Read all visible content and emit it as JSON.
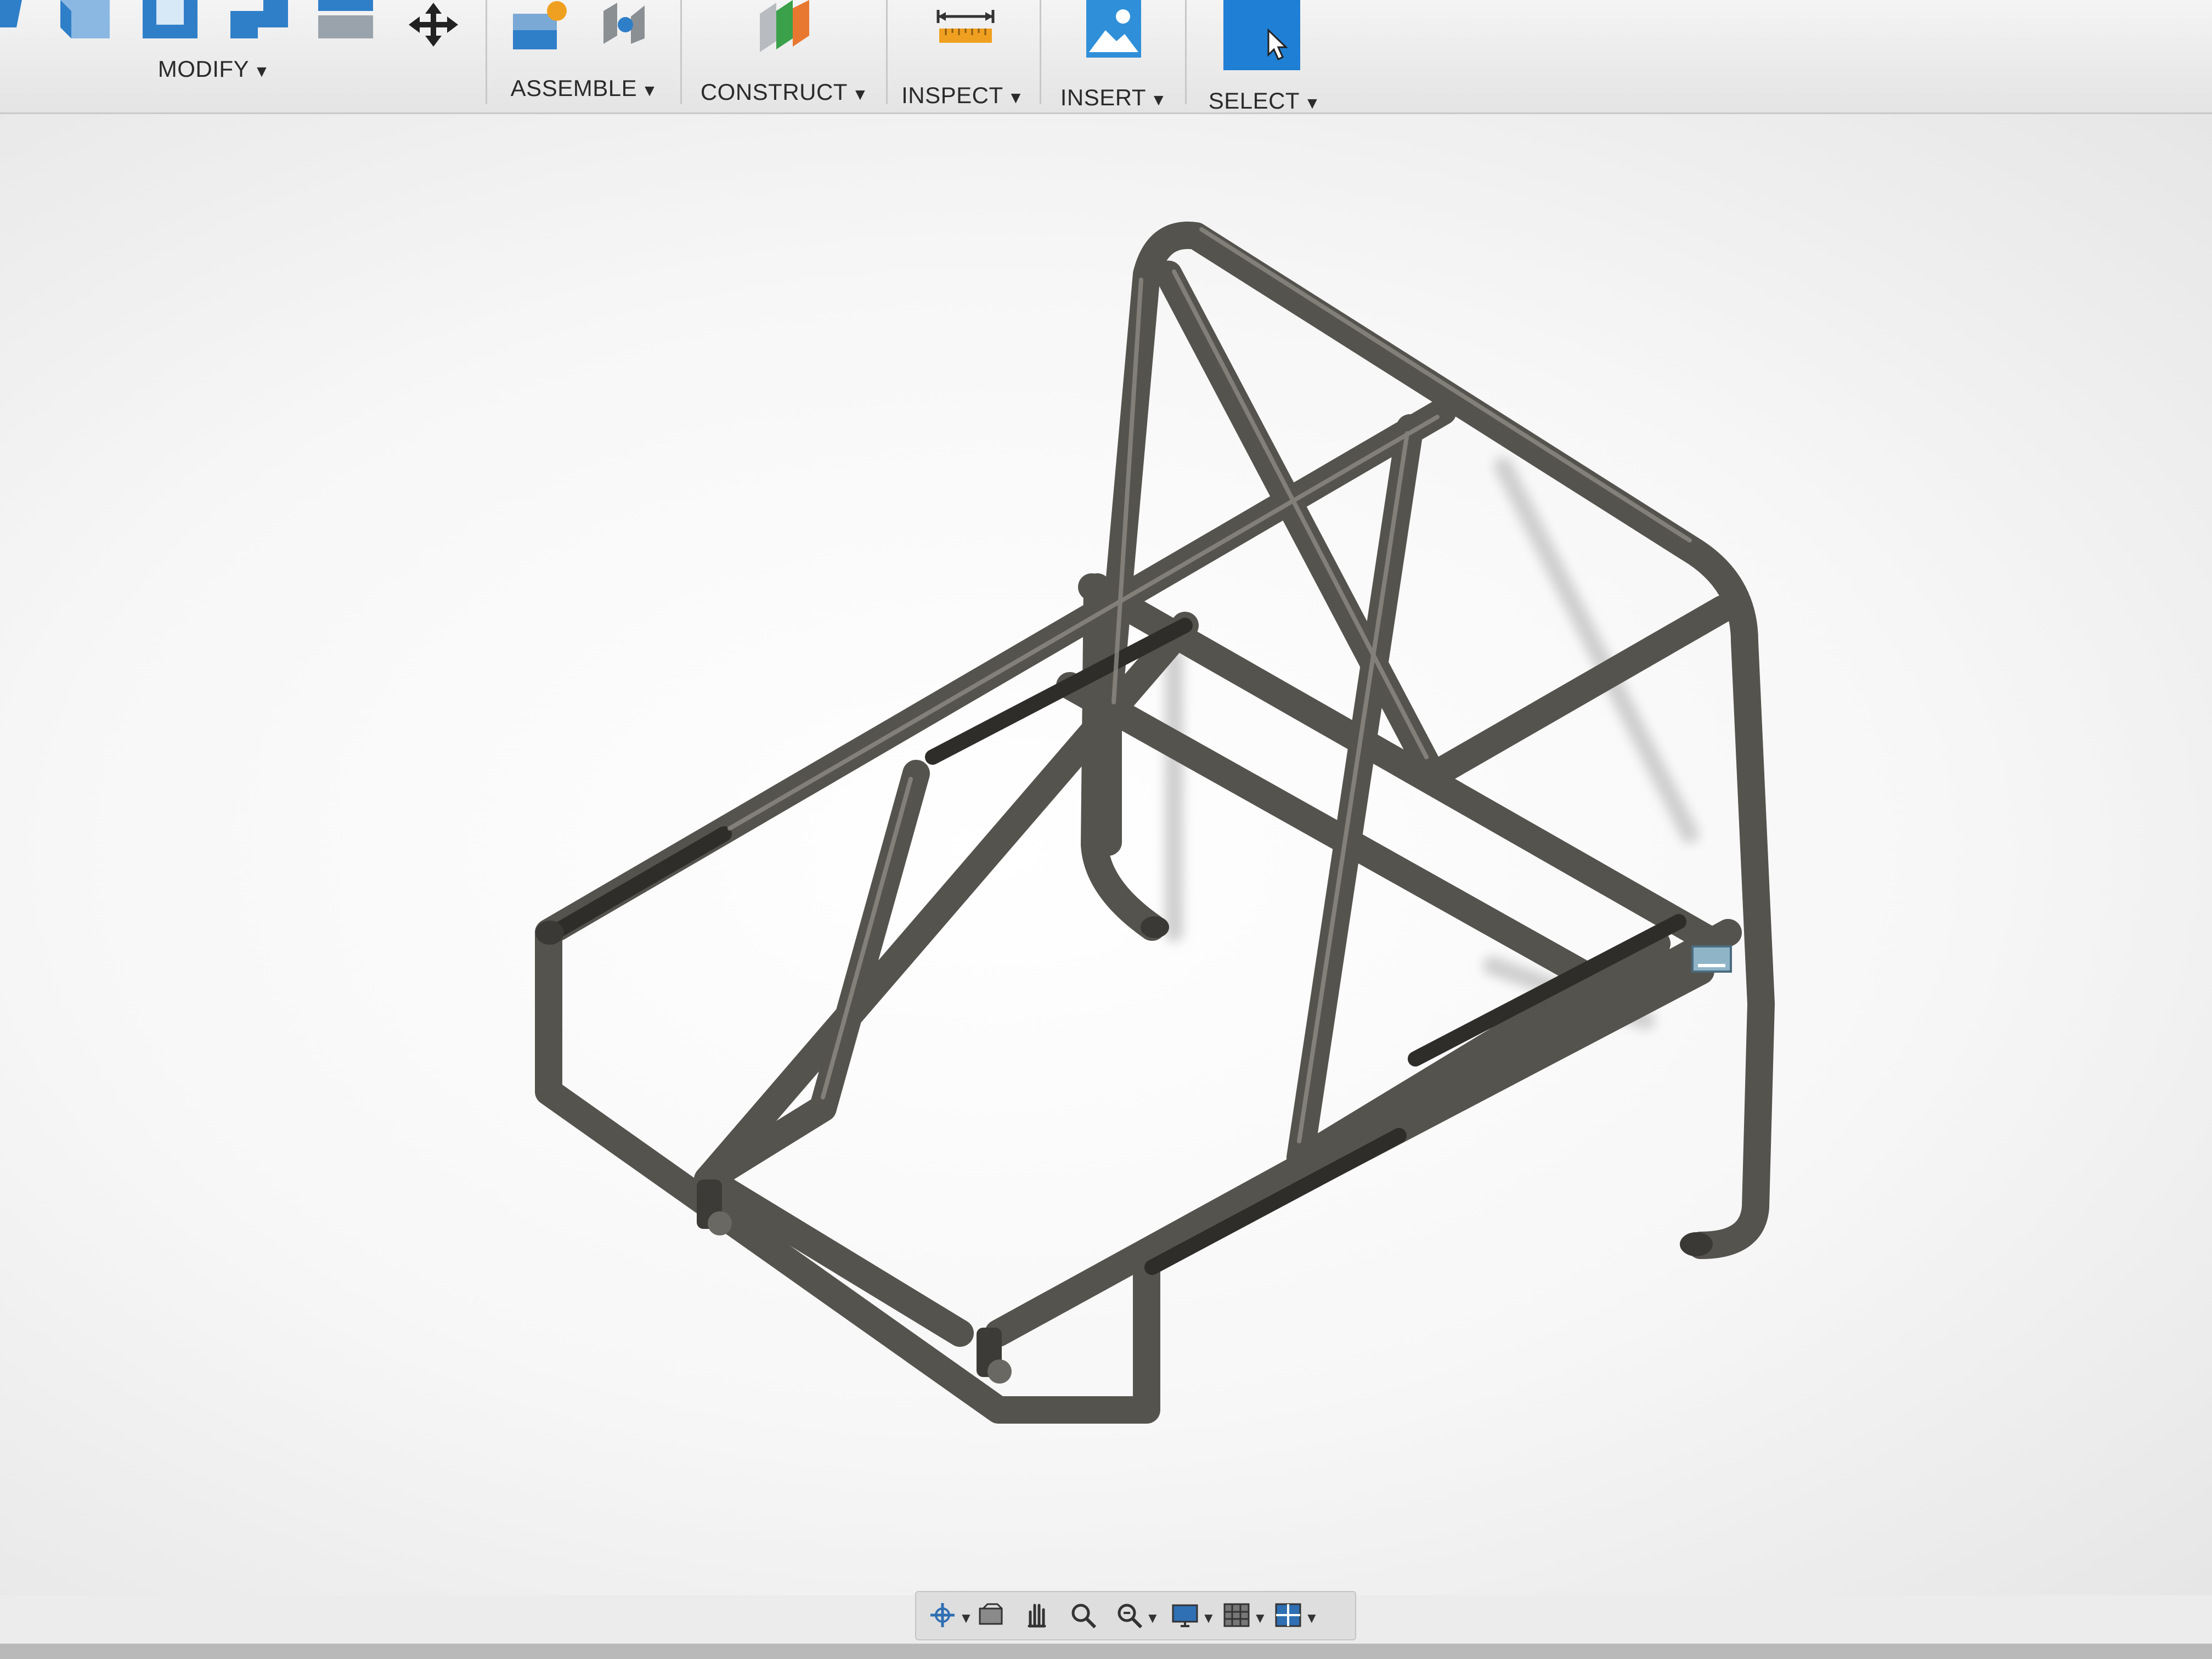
{
  "toolbar": {
    "groups": [
      {
        "label": "MODIFY",
        "caret": "▼"
      },
      {
        "label": "ASSEMBLE",
        "caret": "▼"
      },
      {
        "label": "CONSTRUCT",
        "caret": "▼"
      },
      {
        "label": "INSPECT",
        "caret": "▼"
      },
      {
        "label": "INSERT",
        "caret": "▼"
      },
      {
        "label": "SELECT",
        "caret": "▼"
      }
    ]
  },
  "canvas": {
    "model": "tube frame roll cage"
  },
  "navbar": {
    "items": [
      "orbit-icon",
      "look-at-icon",
      "pan-icon",
      "zoom-icon",
      "fit-icon",
      "display-settings-icon",
      "grid-settings-icon",
      "viewports-icon"
    ]
  },
  "colors": {
    "accent": "#1f7fd4",
    "tube": "#55534e",
    "tube_dark": "#2e2d2a"
  }
}
